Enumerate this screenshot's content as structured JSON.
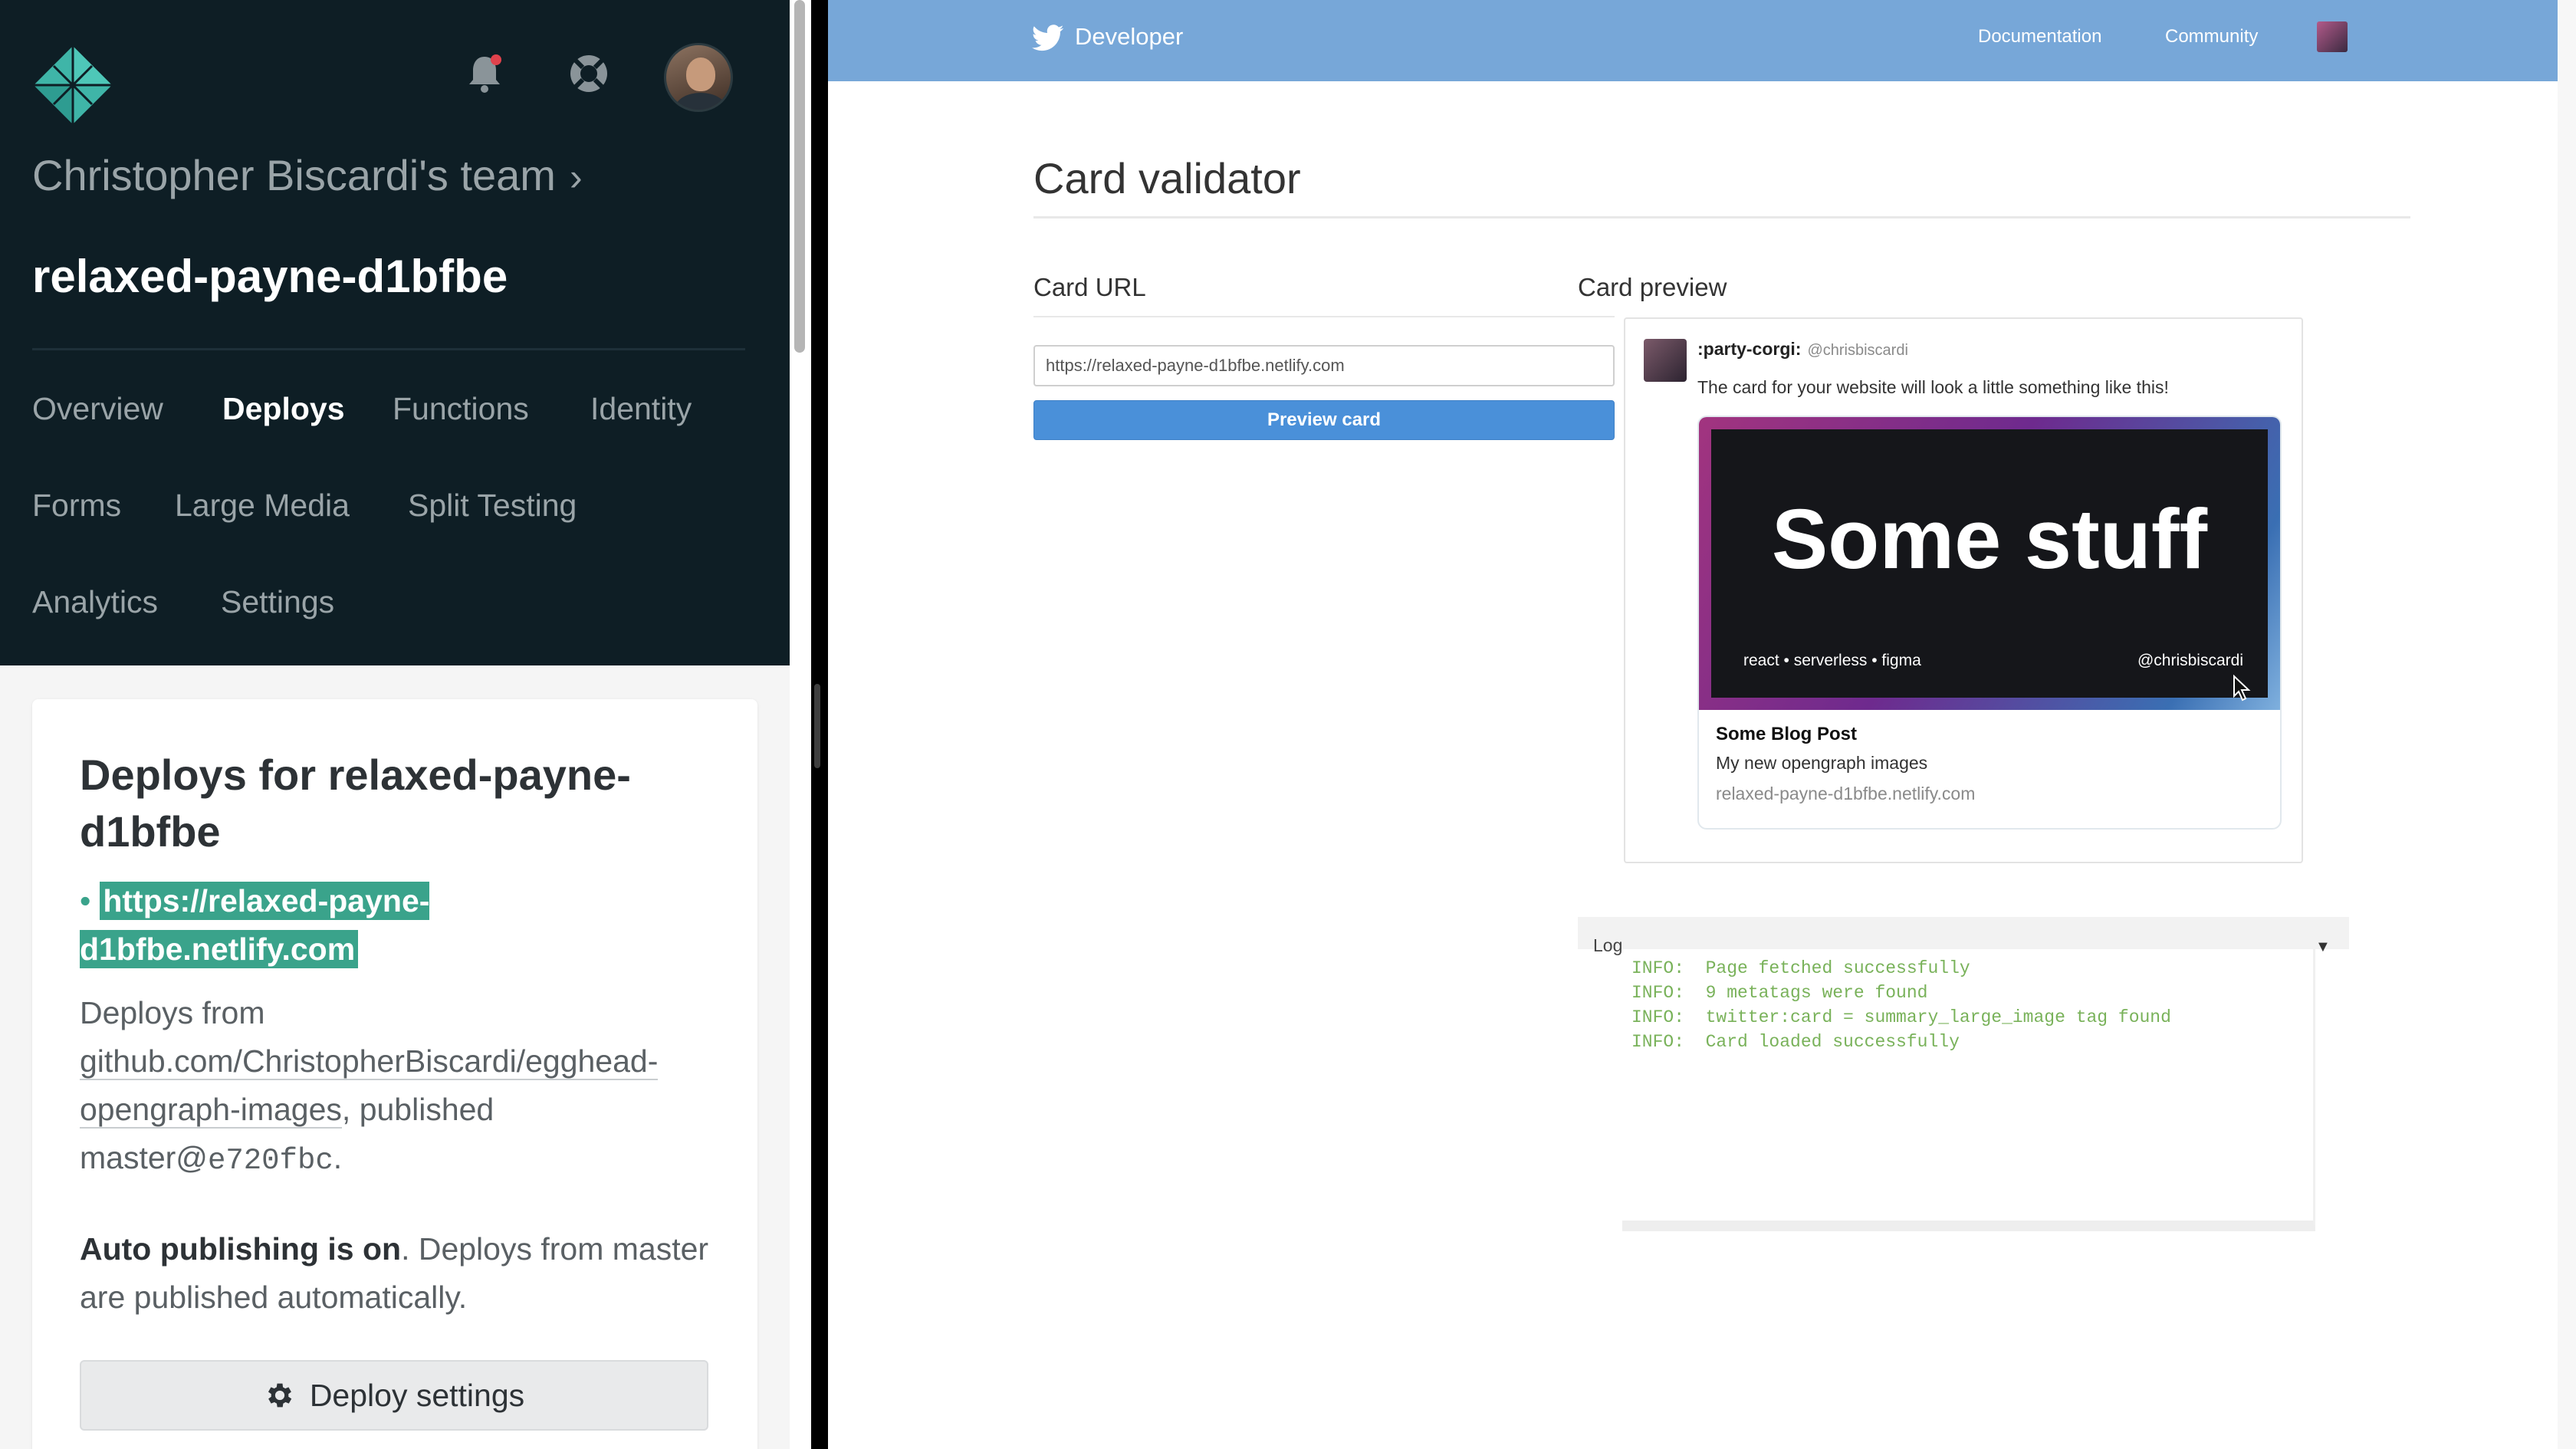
{
  "netlify": {
    "logo_icon": "netlify-diamond-logo",
    "header_icons": [
      "bell-icon",
      "lifebuoy-icon"
    ],
    "team_name": "Christopher Biscardi's team",
    "team_chevron": "›",
    "site_name": "relaxed-payne-d1bfbe",
    "nav": {
      "overview": "Overview",
      "deploys": "Deploys",
      "functions": "Functions",
      "identity": "Identity",
      "forms": "Forms",
      "large_media": "Large Media",
      "split_testing": "Split Testing",
      "analytics": "Analytics",
      "settings": "Settings"
    },
    "active_nav": "Deploys",
    "deploys_card": {
      "title": "Deploys for relaxed-payne-d1bfbe",
      "url": "https://relaxed-payne-d1bfbe.netlify.com",
      "deploys_from_prefix": "Deploys from",
      "repo": "github.com/ChristopherBiscardi/egghead-opengraph-images",
      "published_text": ", published",
      "branch_commit": "master@e720fbc",
      "period": ".",
      "auto_publish_bold": "Auto publishing is on",
      "auto_publish_rest": ". Deploys from master are published automatically.",
      "button_label": "Deploy settings"
    }
  },
  "twitter": {
    "brand": "Developer",
    "nav_documentation": "Documentation",
    "nav_community": "Community",
    "page_title": "Card validator",
    "card_url_label": "Card URL",
    "card_url_value": "https://relaxed-payne-d1bfbe.netlify.com",
    "preview_button": "Preview card",
    "card_preview_label": "Card preview",
    "preview": {
      "display_name": ":party-corgi:",
      "handle": "@chrisbiscardi",
      "tweet_text": "The card for your website will look a little something like this!",
      "image_headline": "Some stuff",
      "image_tags": "react • serverless • figma",
      "image_handle": "@chrisbiscardi",
      "card_title": "Some Blog Post",
      "card_description": "My new opengraph images",
      "card_domain": "relaxed-payne-d1bfbe.netlify.com"
    },
    "log": {
      "label": "Log",
      "toggle": "▼",
      "lines": [
        "INFO:  Page fetched successfully",
        "INFO:  9 metatags were found",
        "INFO:  twitter:card = summary_large_image tag found",
        "INFO:  Card loaded successfully"
      ]
    }
  },
  "colors": {
    "netlify_header": "#0e1e25",
    "netlify_accent": "#3aa38b",
    "twitter_bar": "#77a7d8",
    "twitter_button": "#4a90d9",
    "log_text": "#79b25a"
  }
}
